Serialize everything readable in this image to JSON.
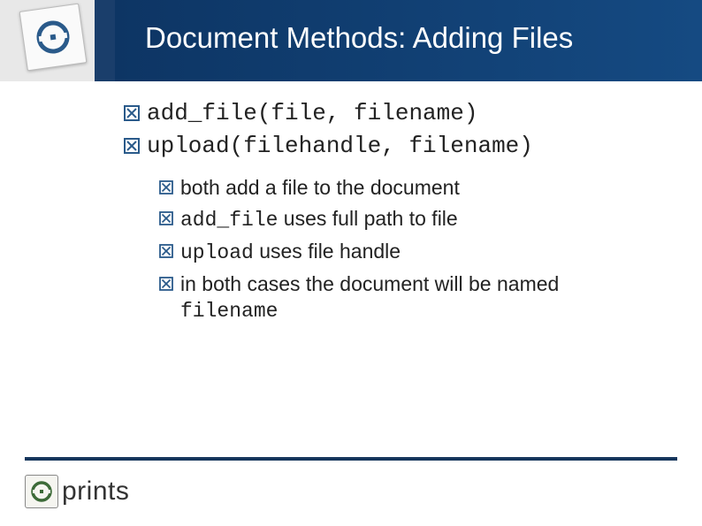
{
  "header": {
    "title": "Document Methods: Adding Files"
  },
  "main_bullets": [
    {
      "code": "add_file(file, filename)"
    },
    {
      "code": "upload(filehandle, filename)"
    }
  ],
  "sub_bullets": [
    {
      "seg1": "both add a file to the document",
      "mono1": "",
      "seg2": ""
    },
    {
      "seg1": "",
      "mono1": "add_file",
      "seg2": " uses full path to file"
    },
    {
      "seg1": "",
      "mono1": "upload",
      "seg2": " uses file handle"
    },
    {
      "seg1": "in both cases the document will be named ",
      "mono1": "filename",
      "seg2": ""
    }
  ],
  "footer": {
    "brand_prefix": "e",
    "brand_rest": "prints"
  }
}
